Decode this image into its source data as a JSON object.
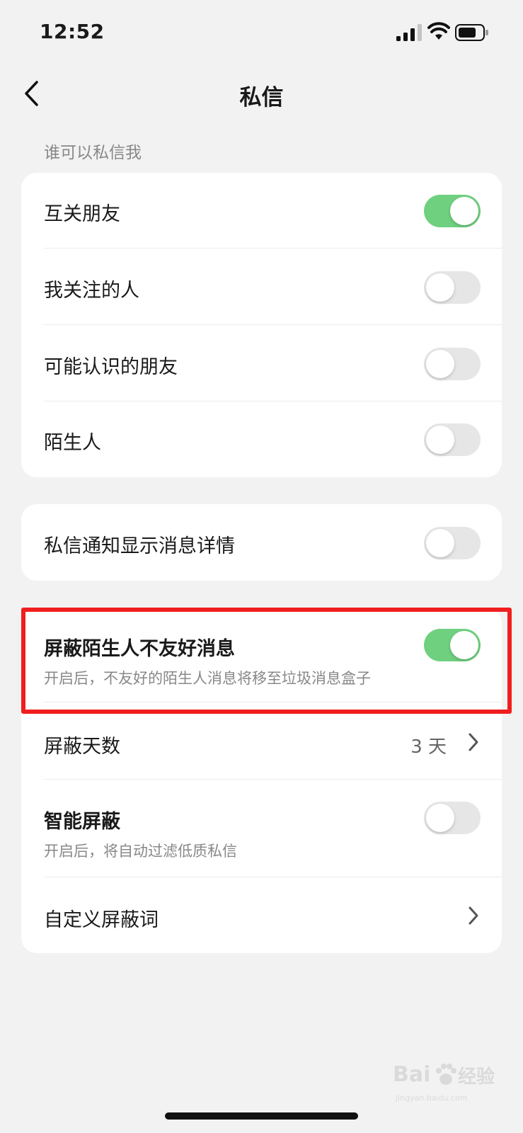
{
  "status_bar": {
    "time": "12:52"
  },
  "nav": {
    "title": "私信"
  },
  "section_title": "谁可以私信我",
  "who_can_message": [
    {
      "label": "互关朋友",
      "on": true
    },
    {
      "label": "我关注的人",
      "on": false
    },
    {
      "label": "可能认识的朋友",
      "on": false
    },
    {
      "label": "陌生人",
      "on": false
    }
  ],
  "notification": {
    "label": "私信通知显示消息详情",
    "on": false
  },
  "block": {
    "unfriendly": {
      "label": "屏蔽陌生人不友好消息",
      "desc": "开启后，不友好的陌生人消息将移至垃圾消息盒子",
      "on": true
    },
    "days": {
      "label": "屏蔽天数",
      "value": "3 天"
    },
    "smart": {
      "label": "智能屏蔽",
      "desc": "开启后，将自动过滤低质私信",
      "on": false
    },
    "custom_words": {
      "label": "自定义屏蔽词"
    }
  },
  "watermark": {
    "brand": "Bai",
    "brand_suffix": "经验",
    "url": "jingyan.baidu.com"
  },
  "colors": {
    "toggle_on": "#6fd07f",
    "toggle_off": "#e6e6e6",
    "highlight": "#f01e1e",
    "background": "#f2f2f2"
  }
}
